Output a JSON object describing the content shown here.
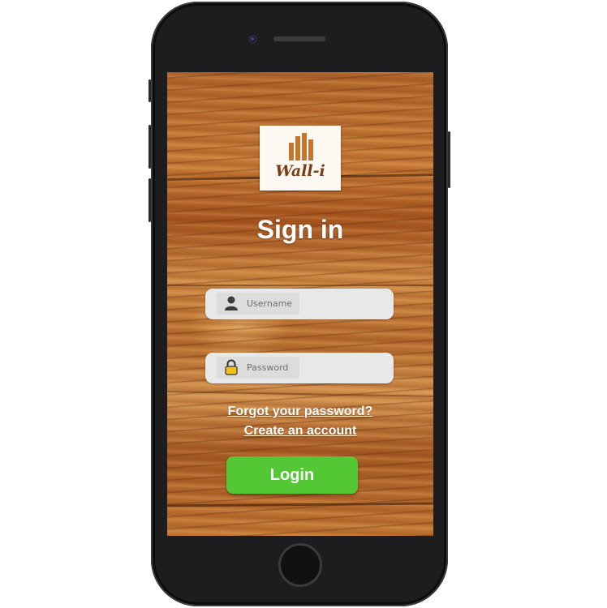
{
  "brand": {
    "logo_text": "Wall-i"
  },
  "page": {
    "title": "Sign in"
  },
  "form": {
    "username": {
      "placeholder": "Username",
      "value": ""
    },
    "password": {
      "placeholder": "Password",
      "value": ""
    }
  },
  "links": {
    "forgot_password": "Forgot your password?",
    "create_account": "Create an account"
  },
  "actions": {
    "login_label": "Login"
  },
  "icons": {
    "username": "user-icon",
    "password": "lock-icon"
  },
  "colors": {
    "login_button": "#54c734",
    "text": "#ffffff",
    "logo_accent": "#c2762e"
  }
}
